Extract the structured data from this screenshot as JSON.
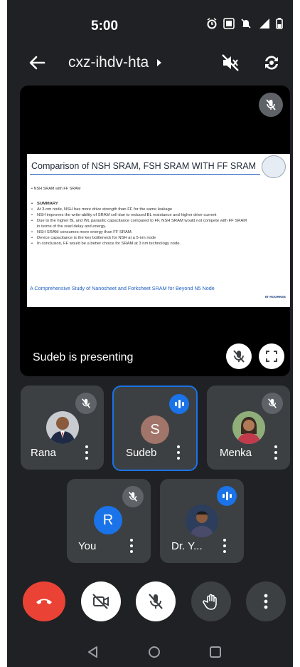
{
  "status_bar": {
    "time": "5:00"
  },
  "top_bar": {
    "meeting_code": "cxz-ihdv-hta"
  },
  "presentation": {
    "presenter_text": "Sudeb is presenting",
    "slide": {
      "title": "Comparison of NSH SRAM, FSH SRAM WITH FF SRAM",
      "subheading": "NSH SRAM with FF SRAM",
      "summary_heading": "SUMMARY",
      "bullets": [
        "At 3-nm node, NSH has more drive strength than FF for the same leakage",
        "NSH improves the write-ability of SRAM cell due to reduced BL resistance and higher drive current",
        "Due to the higher BL and WL parasitic capacitance compared to FF, NSH SRAM would not compete with FF SRAM in terms of the read delay and energy.",
        "NSH SRAM consumes more energy than FF SRAM.",
        "Device capacitance is the key bottleneck for NSH at a 5-nm node",
        "In conclusion, FF would be a better choice for SRAM at 3 nm technology node."
      ],
      "footer": "A Comprehensive Study of Nanosheet and Forksheet SRAM for Beyond N5 Node",
      "brand": "IIT ROORKEE"
    }
  },
  "participants": [
    {
      "name": "Rana",
      "avatar_type": "photo",
      "muted": true
    },
    {
      "name": "Sudeb",
      "avatar_type": "letter",
      "initial": "S",
      "avatar_color": "#a1756a",
      "speaking": true,
      "active": true
    },
    {
      "name": "Menka",
      "avatar_type": "photo",
      "muted": true
    },
    {
      "name": "You",
      "avatar_type": "letter",
      "initial": "R",
      "avatar_color": "#1a73e8",
      "muted": true
    },
    {
      "name": "Dr. Y...",
      "avatar_type": "photo",
      "speaking": true
    }
  ],
  "controls": [
    "end-call",
    "camera-off",
    "mic-off",
    "raise-hand",
    "more-options"
  ],
  "colors": {
    "background": "#202124",
    "tile": "#3c4043",
    "accent": "#1a73e8",
    "end_call": "#ea4335"
  }
}
